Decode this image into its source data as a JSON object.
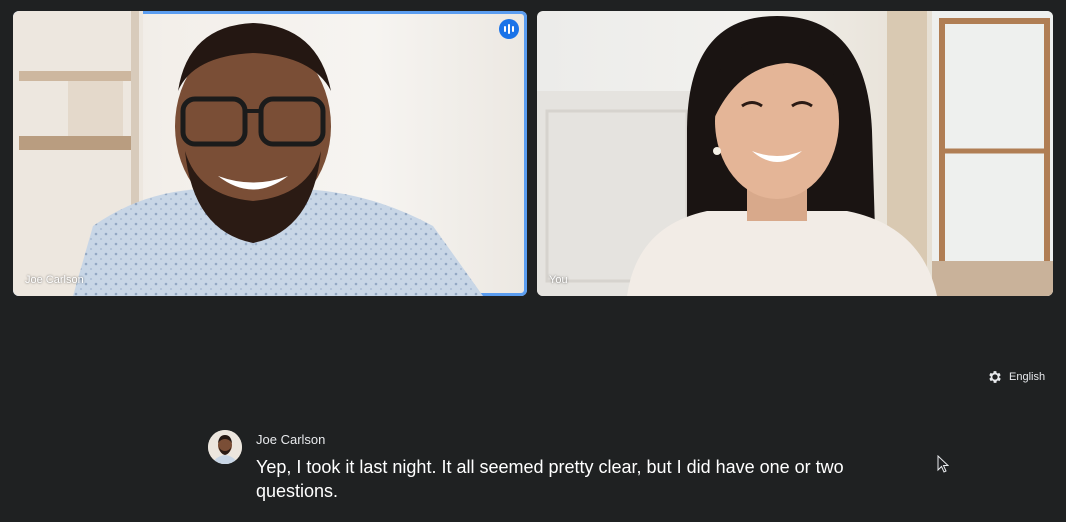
{
  "participants": [
    {
      "name": "Joe Carlson",
      "speaking": true
    },
    {
      "name": "You",
      "speaking": false
    }
  ],
  "language": {
    "label": "English",
    "icon": "gear-icon"
  },
  "caption": {
    "speaker": "Joe Carlson",
    "text": "Yep, I took it last night. It all seemed pretty clear, but I did have one or two questions."
  },
  "colors": {
    "background": "#1f2122",
    "active_speaker_border": "#5b9df0",
    "speaking_indicator": "#1a73e8"
  }
}
